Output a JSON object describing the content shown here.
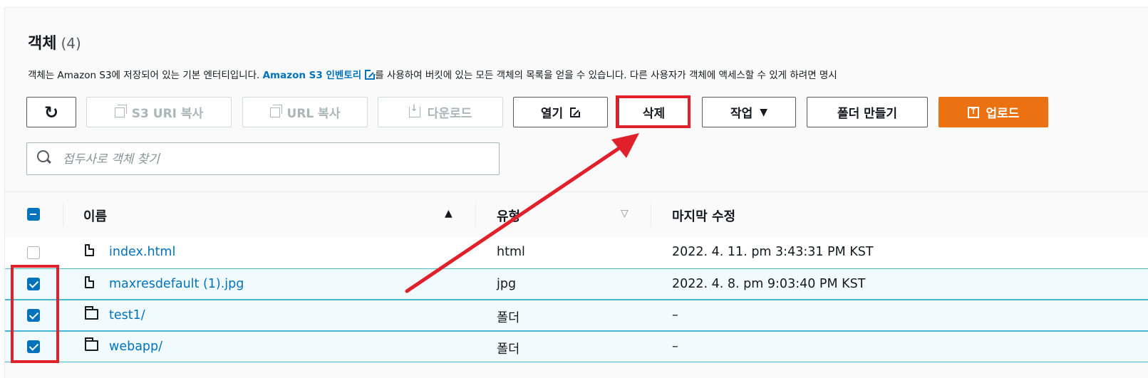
{
  "header": {
    "title": "객체",
    "count": "(4)",
    "desc_before": "객체는 Amazon S3에 저장되어 있는 기본 엔터티입니다. ",
    "desc_link": "Amazon S3 인벤토리",
    "desc_after": "를 사용하여 버킷에 있는 모든 객체의 목록을 얻을 수 있습니다. 다른 사용자가 객체에 액세스할 수 있게 하려면 명시"
  },
  "toolbar": {
    "refresh_icon": "refresh-icon",
    "copy_s3_uri": "S3 URI 복사",
    "copy_url": "URL 복사",
    "download": "다운로드",
    "open": "열기",
    "delete": "삭제",
    "actions": "작업",
    "create_folder": "폴더 만들기",
    "upload": "업로드"
  },
  "search": {
    "placeholder": "접두사로 객체 찾기"
  },
  "table": {
    "columns": {
      "name": "이름",
      "type": "유형",
      "modified": "마지막 수정"
    },
    "rows": [
      {
        "name": "index.html",
        "type": "html",
        "modified": "2022. 4. 11. pm 3:43:31 PM KST",
        "checked": false,
        "icon": "file-icon"
      },
      {
        "name": "maxresdefault (1).jpg",
        "type": "jpg",
        "modified": "2022. 4. 8. pm 9:03:40 PM KST",
        "checked": true,
        "icon": "file-icon"
      },
      {
        "name": "test1/",
        "type": "폴더",
        "modified": "–",
        "checked": true,
        "icon": "folder-icon"
      },
      {
        "name": "webapp/",
        "type": "폴더",
        "modified": "–",
        "checked": true,
        "icon": "folder-icon"
      }
    ]
  },
  "colors": {
    "accent": "#0073bb",
    "primary": "#ec7211",
    "highlight": "#e0202b"
  }
}
